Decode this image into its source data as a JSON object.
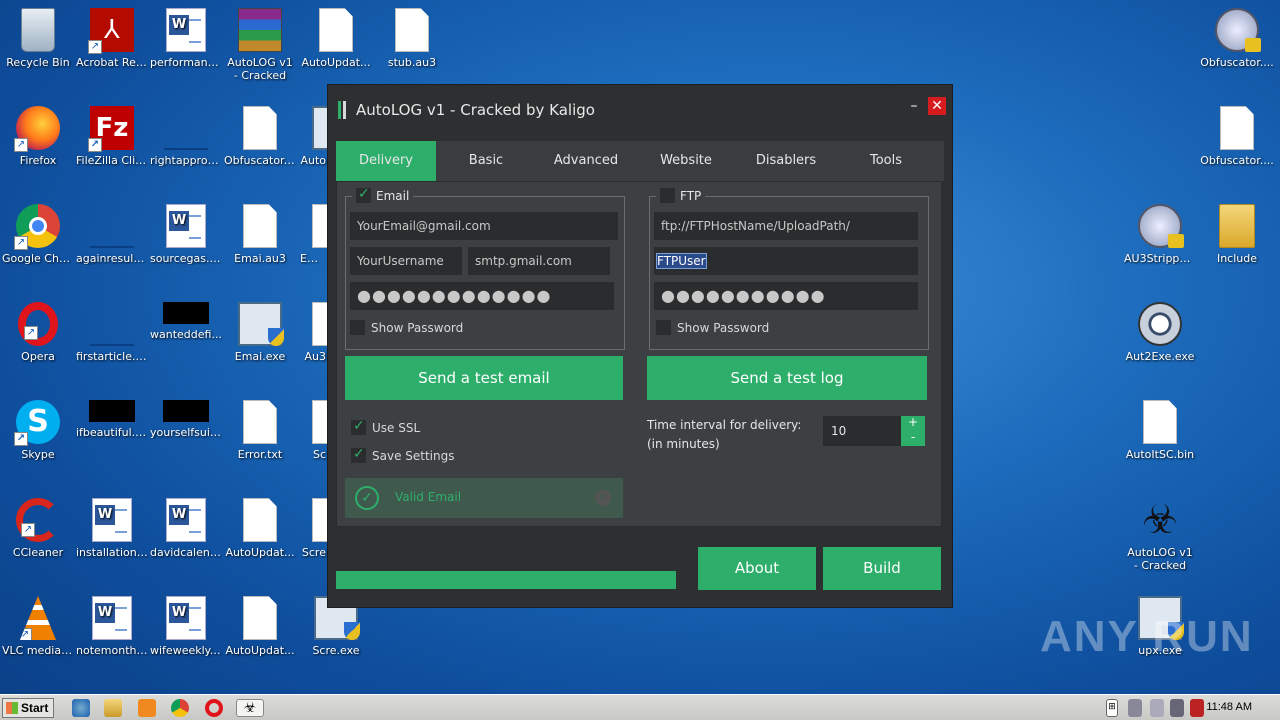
{
  "desktop": {
    "icons": [
      {
        "label": "Recycle Bin"
      },
      {
        "label": "Acrobat Reader DC"
      },
      {
        "label": "performanc..."
      },
      {
        "label": "AutoLOG v1 - Cracked b..."
      },
      {
        "label": "AutoUpdat..."
      },
      {
        "label": "stub.au3"
      },
      {
        "label": "Firefox"
      },
      {
        "label": "FileZilla Client"
      },
      {
        "label": "rightapproa..."
      },
      {
        "label": "Obfuscator...."
      },
      {
        "label": "Auto"
      },
      {
        "label": "Google Chrome"
      },
      {
        "label": "againresult...."
      },
      {
        "label": "sourcegas.rtf"
      },
      {
        "label": "Emai.au3"
      },
      {
        "label": "Emai"
      },
      {
        "label": "Opera"
      },
      {
        "label": "firstarticle.png"
      },
      {
        "label": "wanteddefi..."
      },
      {
        "label": "Emai.exe"
      },
      {
        "label": "Au3"
      },
      {
        "label": "Skype"
      },
      {
        "label": "ifbeautiful.jpg"
      },
      {
        "label": "yourselfsuit..."
      },
      {
        "label": "Error.txt"
      },
      {
        "label": "Sc"
      },
      {
        "label": "CCleaner"
      },
      {
        "label": "installationsi..."
      },
      {
        "label": "davidcalend..."
      },
      {
        "label": "AutoUpdat..."
      },
      {
        "label": "Scre"
      },
      {
        "label": "VLC media player"
      },
      {
        "label": "notemonthl..."
      },
      {
        "label": "wifeweekly.rtf"
      },
      {
        "label": "AutoUpdat..."
      },
      {
        "label": "Scre.exe"
      },
      {
        "label": "Obfuscator...."
      },
      {
        "label": "Obfuscator...."
      },
      {
        "label": "AU3Strippe..."
      },
      {
        "label": "Include"
      },
      {
        "label": "Aut2Exe.exe"
      },
      {
        "label": "AutoItSC.bin"
      },
      {
        "label": "AutoLOG v1 - Cracked b..."
      },
      {
        "label": "upx.exe"
      }
    ]
  },
  "watermark": "ANY RUN",
  "taskbar": {
    "start": "Start",
    "clock": "11:48 AM"
  },
  "app": {
    "title": "AutoLOG v1 - Cracked by Kaligo",
    "minimize": "–",
    "close": "✕",
    "tabs": [
      "Delivery",
      "Basic",
      "Advanced",
      "Website",
      "Disablers",
      "Tools"
    ],
    "active_tab": "Delivery",
    "email": {
      "title": "Email",
      "enabled": true,
      "address": "YourEmail@gmail.com",
      "username": "YourUsername",
      "smtp": "smtp.gmail.com",
      "password": "●●●●●●●●●●●●●",
      "show_password": "Show Password",
      "test_button": "Send a test email",
      "use_ssl": "Use SSL",
      "save_settings": "Save Settings",
      "valid": "Valid Email"
    },
    "ftp": {
      "title": "FTP",
      "enabled": false,
      "host": "ftp://FTPHostName/UploadPath/",
      "user": "FTPUser",
      "password": "●●●●●●●●●●●",
      "show_password": "Show Password",
      "test_button": "Send a test log"
    },
    "interval": {
      "label_line1": "Time interval for delivery:",
      "label_line2": "(in minutes)",
      "value": "10",
      "plus": "+",
      "minus": "-"
    },
    "progress": 1.0,
    "about": "About",
    "build": "Build"
  },
  "colors": {
    "accent": "#2eae6b",
    "window_bg": "#2d2f31",
    "close_red": "#d71c20"
  }
}
